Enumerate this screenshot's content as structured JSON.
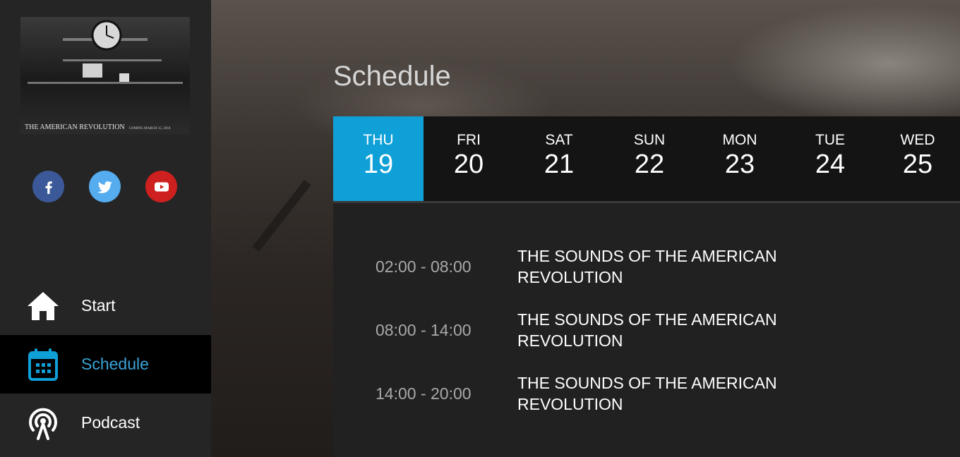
{
  "logo": {
    "caption": "THE AMERICAN REVOLUTION",
    "subcaption": "COMING MARCH 15, 2018"
  },
  "social": [
    {
      "name": "facebook",
      "icon": "facebook-icon",
      "color": "#3b5998"
    },
    {
      "name": "twitter",
      "icon": "twitter-icon",
      "color": "#55acee"
    },
    {
      "name": "youtube",
      "icon": "youtube-icon",
      "color": "#cd201f"
    }
  ],
  "nav": {
    "items": [
      {
        "label": "Start",
        "icon": "home-icon",
        "active": false
      },
      {
        "label": "Schedule",
        "icon": "calendar-icon",
        "active": true
      },
      {
        "label": "Podcast",
        "icon": "podcast-icon",
        "active": false
      }
    ]
  },
  "page": {
    "title": "Schedule"
  },
  "days": [
    {
      "name": "THU",
      "num": "19",
      "active": true
    },
    {
      "name": "FRI",
      "num": "20",
      "active": false
    },
    {
      "name": "SAT",
      "num": "21",
      "active": false
    },
    {
      "name": "SUN",
      "num": "22",
      "active": false
    },
    {
      "name": "MON",
      "num": "23",
      "active": false
    },
    {
      "name": "TUE",
      "num": "24",
      "active": false
    },
    {
      "name": "WED",
      "num": "25",
      "active": false
    }
  ],
  "schedule": [
    {
      "time": "02:00 - 08:00",
      "title": "THE SOUNDS OF THE AMERICAN REVOLUTION"
    },
    {
      "time": "08:00 - 14:00",
      "title": "THE SOUNDS OF THE AMERICAN REVOLUTION"
    },
    {
      "time": "14:00 - 20:00",
      "title": "THE SOUNDS OF THE AMERICAN REVOLUTION"
    }
  ],
  "colors": {
    "accent": "#0fa0d8",
    "active_nav_text": "#3aa3d6"
  }
}
